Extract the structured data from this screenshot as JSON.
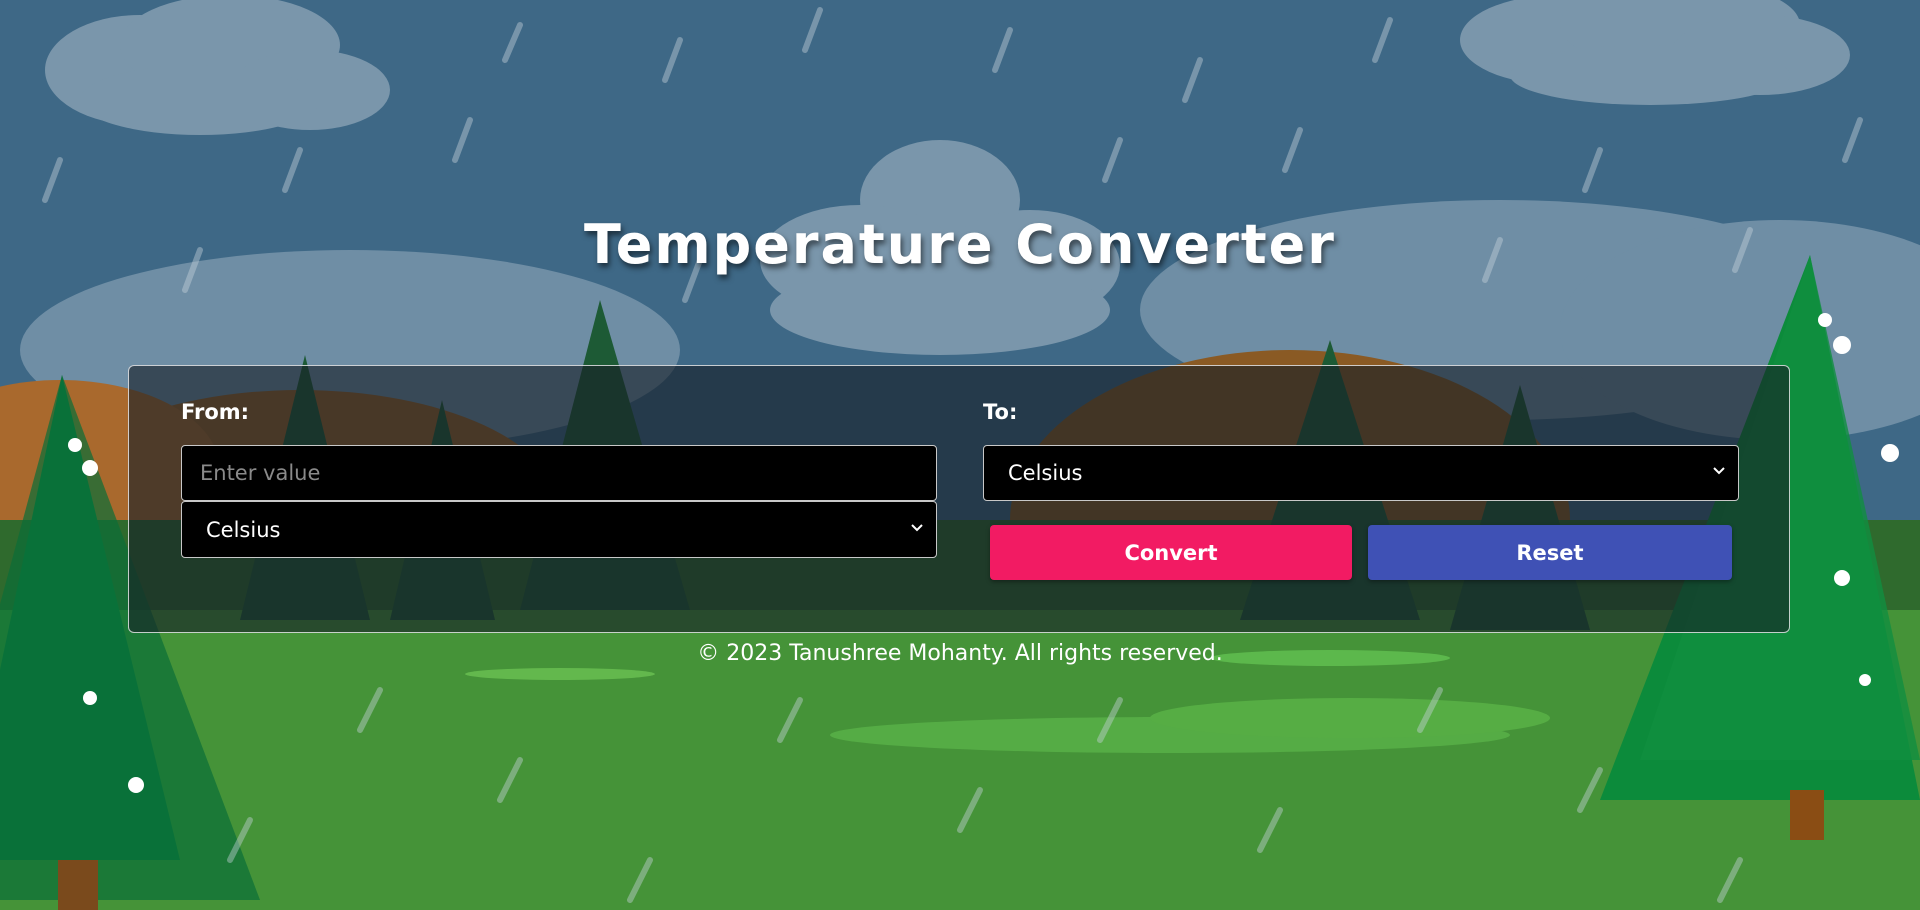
{
  "header": {
    "title": "Temperature Converter"
  },
  "converter": {
    "from_label": "From:",
    "to_label": "To:",
    "value_input": {
      "value": "",
      "placeholder": "Enter value"
    },
    "from_unit_selected": "Celsius",
    "to_unit_selected": "Celsius",
    "convert_label": "Convert",
    "reset_label": "Reset"
  },
  "footer": {
    "text": "© 2023 Tanushree Mohanty. All rights reserved."
  },
  "colors": {
    "convert_button": "#f21b63",
    "reset_button": "#3f51b5",
    "sky": "#3f6a89",
    "grass": "#449238"
  }
}
